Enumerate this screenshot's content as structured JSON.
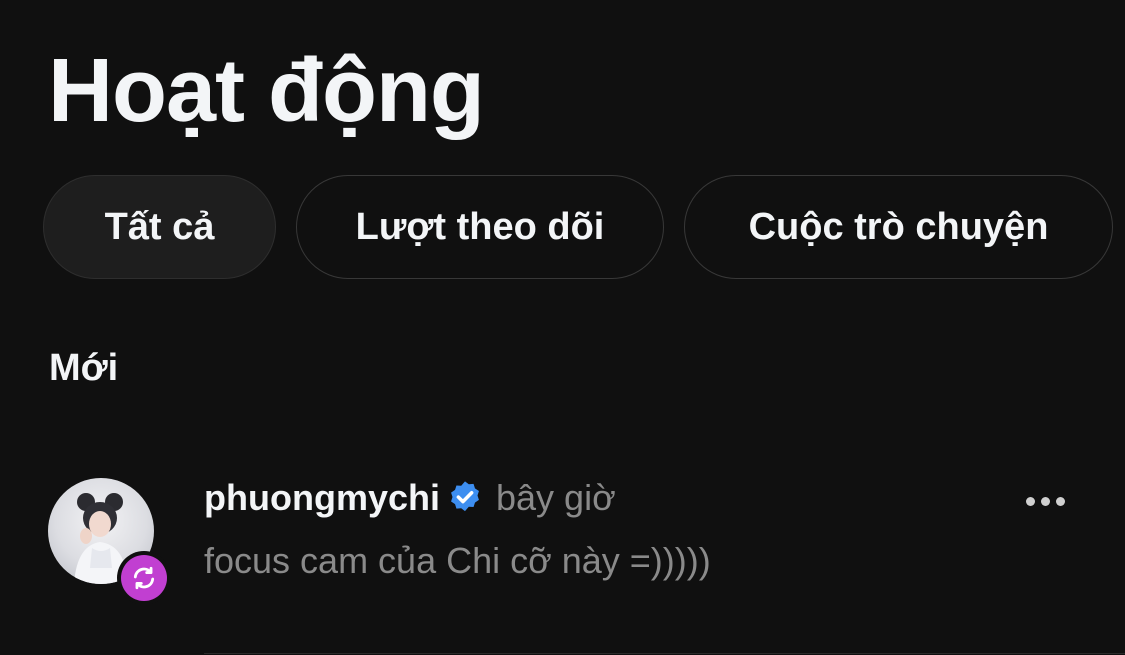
{
  "page": {
    "title": "Hoạt động"
  },
  "filters": [
    {
      "label": "Tất cả",
      "active": true
    },
    {
      "label": "Lượt theo dõi",
      "active": false
    },
    {
      "label": "Cuộc trò chuyện",
      "active": false
    }
  ],
  "sections": {
    "new_heading": "Mới"
  },
  "activities": [
    {
      "username": "phuongmychi",
      "verified": true,
      "timestamp": "bây giờ",
      "snippet": "focus cam của Chi cỡ này =)))))",
      "badge_icon": "repost-icon",
      "badge_color": "#c13fd1"
    }
  ],
  "colors": {
    "background": "#101010",
    "text_primary": "#f3f5f7",
    "text_secondary": "#8a8a8a",
    "verified_blue": "#3d8ef0",
    "chip_border": "#383838"
  }
}
